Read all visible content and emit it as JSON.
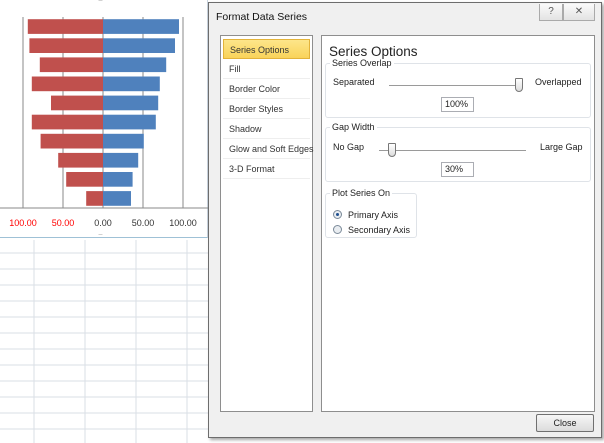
{
  "chart_data": {
    "type": "bar",
    "orientation": "horizontal",
    "series": [
      {
        "color": "#c0504d",
        "values": [
          -94,
          -92,
          -79,
          -89,
          -65,
          -89,
          -78,
          -56,
          -46,
          -21
        ]
      },
      {
        "color": "#4f81bd",
        "values": [
          95,
          90,
          79,
          71,
          69,
          66,
          51,
          44,
          37,
          35
        ]
      }
    ],
    "xlim": [
      -100,
      100
    ],
    "xticks": [
      -100,
      -50,
      0,
      50,
      100
    ],
    "xtick_labels": [
      "100.00",
      "50.00",
      "0.00",
      "50.00",
      "100.00"
    ],
    "negative_tick_color": "#ff0000",
    "grid": "vertical",
    "overlap_percent": 100,
    "gap_width_percent": 30
  },
  "dialog": {
    "title": "Format Data Series",
    "help_icon": "?",
    "close_icon": "✕",
    "nav": [
      "Series Options",
      "Fill",
      "Border Color",
      "Border Styles",
      "Shadow",
      "Glow and Soft Edges",
      "3-D Format"
    ],
    "content_title": "Series Options",
    "overlap": {
      "legend": "Series Overlap",
      "left": "Separated",
      "right": "Overlapped",
      "value": "100%",
      "level": 100
    },
    "gap": {
      "legend": "Gap Width",
      "left": "No Gap",
      "right": "Large Gap",
      "value": "30%",
      "level": 6
    },
    "plot_on": {
      "legend": "Plot Series On",
      "primary": "Primary Axis",
      "secondary": "Secondary Axis",
      "selected": "primary"
    },
    "close_label": "Close"
  }
}
